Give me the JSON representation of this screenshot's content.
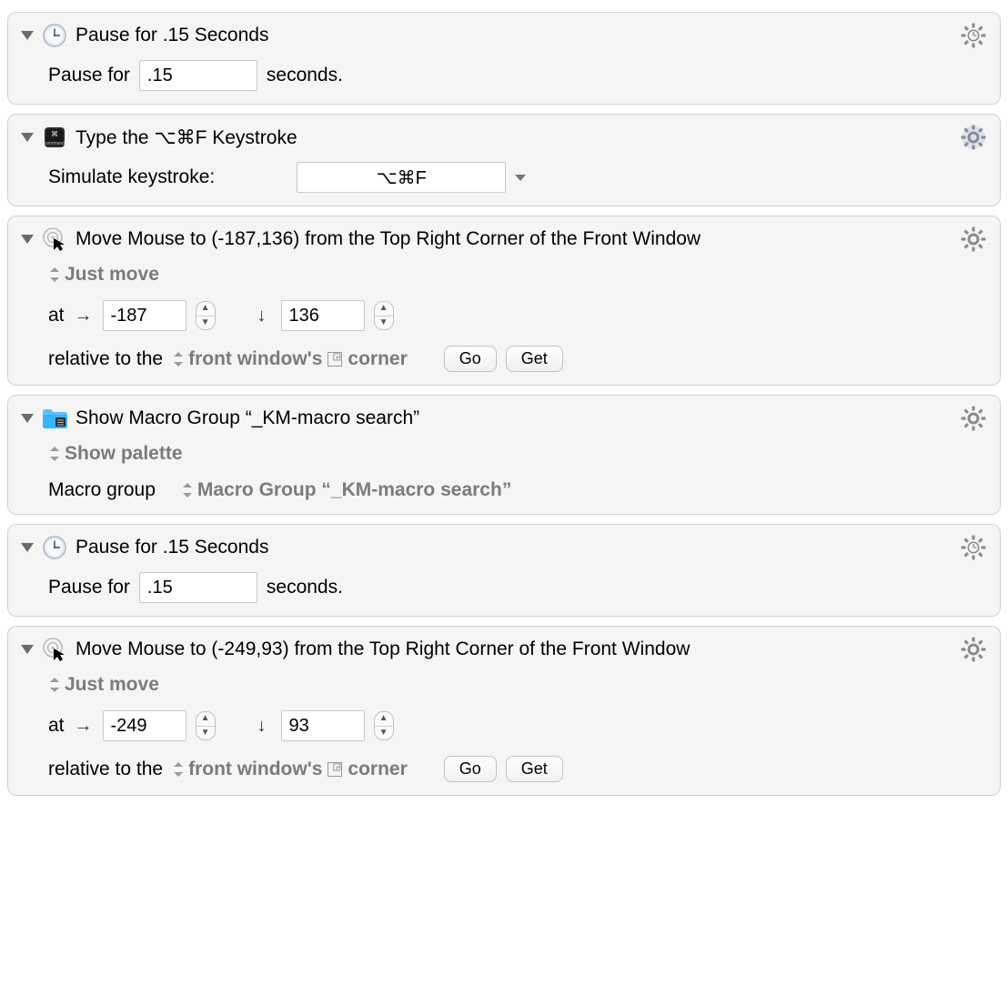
{
  "actions": [
    {
      "type": "pause",
      "title": "Pause for .15 Seconds",
      "label": "Pause for",
      "value": ".15",
      "unit": "seconds."
    },
    {
      "type": "keystroke",
      "title": "Type the ⌥⌘F Keystroke",
      "label": "Simulate keystroke:",
      "value": "⌥⌘F"
    },
    {
      "type": "mouse",
      "title": "Move Mouse to (-187,136) from the Top Right Corner of the Front Window",
      "mode": "Just move",
      "at": "at",
      "x": "-187",
      "y": "136",
      "relLabel": "relative to the",
      "relValue": "front window's",
      "relSuffix": "corner",
      "goLabel": "Go",
      "getLabel": "Get"
    },
    {
      "type": "macrogroup",
      "title": "Show Macro Group “_KM-macro search”",
      "mode": "Show palette",
      "label": "Macro group",
      "group": "Macro Group “_KM-macro search”"
    },
    {
      "type": "pause",
      "title": "Pause for .15 Seconds",
      "label": "Pause for",
      "value": ".15",
      "unit": "seconds."
    },
    {
      "type": "mouse",
      "title": "Move Mouse to (-249,93) from the Top Right Corner of the Front Window",
      "mode": "Just move",
      "at": "at",
      "x": "-249",
      "y": "93",
      "relLabel": "relative to the",
      "relValue": "front window's",
      "relSuffix": "corner",
      "goLabel": "Go",
      "getLabel": "Get"
    }
  ]
}
